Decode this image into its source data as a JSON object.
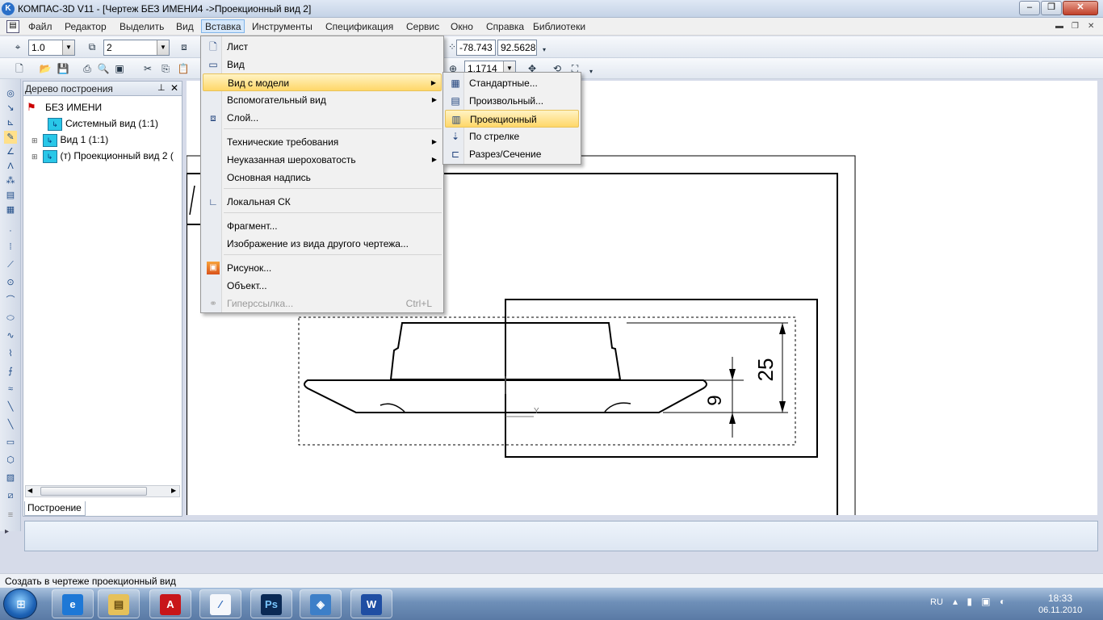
{
  "window": {
    "title": "КОМПАС-3D V11 - [Чертеж БЕЗ ИМЕНИ4 ->Проекционный вид 2]",
    "app_icon": "K"
  },
  "menubar": {
    "items": [
      "Файл",
      "Редактор",
      "Выделить",
      "Вид",
      "Вставка",
      "Инструменты",
      "Спецификация",
      "Сервис",
      "Окно",
      "Справка",
      "Библиотеки"
    ],
    "active": "Вставка"
  },
  "toolbar": {
    "scale_value": "1.0",
    "layer_value": "2",
    "coord_x": "-78.743",
    "coord_y": "92.5628",
    "zoom_value": "1.1714"
  },
  "tree": {
    "title": "Дерево построения",
    "root": "БЕЗ ИМЕНИ",
    "items": [
      "Системный вид (1:1)",
      "Вид 1 (1:1)",
      "(т) Проекционный вид 2 ("
    ],
    "tab": "Построение"
  },
  "insert_menu": {
    "items": [
      {
        "label": "Лист",
        "icon": "sheet-icon"
      },
      {
        "label": "Вид",
        "icon": "view-icon"
      },
      {
        "label": "Вид с модели",
        "submenu": true
      },
      {
        "label": "Вспомогательный вид",
        "submenu": true
      },
      {
        "label": "Слой...",
        "icon": "layer-icon"
      },
      {
        "label": "Технические требования",
        "submenu": true
      },
      {
        "label": "Неуказанная шероховатость",
        "submenu": true
      },
      {
        "label": "Основная надпись"
      },
      {
        "label": "Локальная СК",
        "icon": "local-cs-icon"
      },
      {
        "label": "Фрагмент..."
      },
      {
        "label": "Изображение из вида другого чертежа..."
      },
      {
        "label": "Рисунок...",
        "icon": "picture-icon"
      },
      {
        "label": "Объект..."
      },
      {
        "label": "Гиперссылка...",
        "icon": "hyperlink-icon",
        "shortcut": "Ctrl+L",
        "disabled": true
      }
    ]
  },
  "submenu_model_view": {
    "items": [
      "Стандартные...",
      "Произвольный...",
      "Проекционный",
      "По стрелке",
      "Разрез/Сечение"
    ],
    "highlighted": "Проекционный"
  },
  "drawing": {
    "dimension_25": "25",
    "dimension_9": "9",
    "axis_label": "Y"
  },
  "status": {
    "text": "Создать в чертеже проекционный вид"
  },
  "taskbar": {
    "lang": "RU",
    "time": "18:33",
    "date": "06.11.2010"
  }
}
